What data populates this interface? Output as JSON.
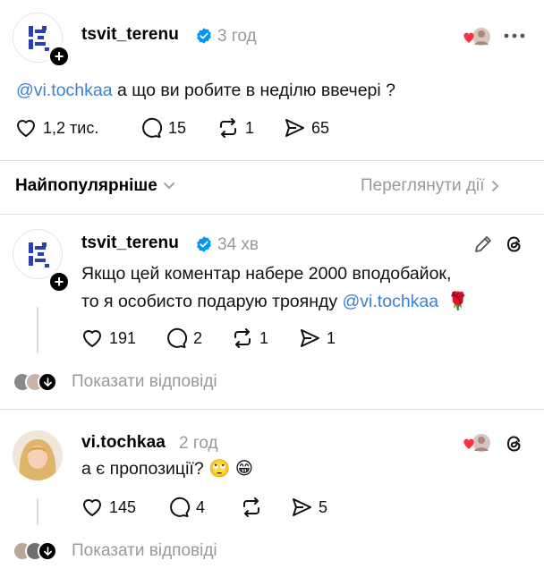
{
  "post": {
    "username": "tsvit_terenu",
    "time": "3 год",
    "text_mention": "@vi.tochkaa",
    "text": " а що ви робите в неділю ввечері ?",
    "likes": "1,2 тис.",
    "comments": "15",
    "reposts": "1",
    "shares": "65",
    "more_icon": "more-horizontal-icon"
  },
  "sort": {
    "label": "Найпопулярніше",
    "activity_label": "Переглянути дії"
  },
  "replies": [
    {
      "username": "tsvit_terenu",
      "time": "34 хв",
      "line1": "Якщо цей коментар набере 2000 вподобайок,",
      "line2": "то я особисто подарую троянду ",
      "line2_mention": "@vi.tochkaa",
      "emoji": "🌹",
      "likes": "191",
      "comments": "2",
      "reposts": "1",
      "shares": "1",
      "show_replies": "Показати відповіді"
    },
    {
      "username": "vi.tochkaa",
      "time": "2 год",
      "text": "а є пропозиції?",
      "emoji": "🙄 😁",
      "likes": "145",
      "comments": "4",
      "reposts": "",
      "shares": "5",
      "show_replies": "Показати відповіді"
    }
  ],
  "colors": {
    "accent": "#3b80d6",
    "verified": "#0095f6",
    "heart": "#ff3040",
    "muted": "#999999"
  }
}
